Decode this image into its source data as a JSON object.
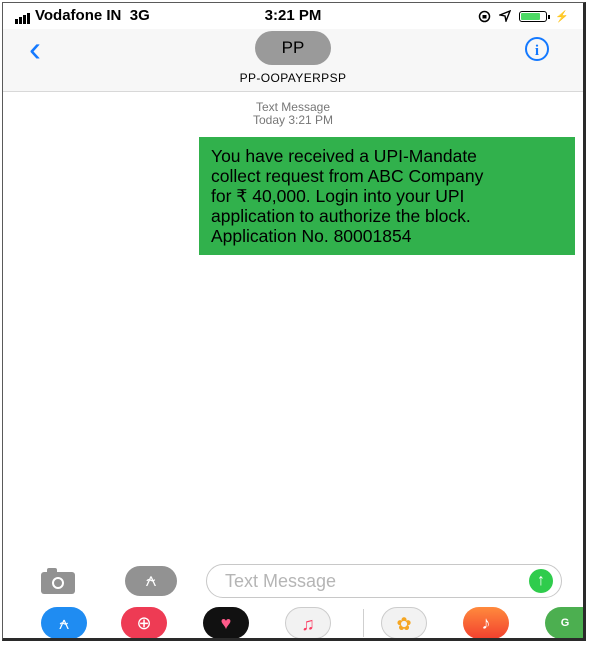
{
  "status_bar": {
    "carrier": "Vodafone IN",
    "network": "3G",
    "time": "3:21 PM",
    "battery_level": 0.8,
    "icons": [
      "signal-bars-icon",
      "lock-rotation-icon",
      "location-arrow-icon",
      "battery-icon",
      "charging-bolt-icon"
    ]
  },
  "header": {
    "back_icon": "chevron-left-icon",
    "avatar_initials": "PP",
    "contact_name": "PP-OOPAYERPSP",
    "info_icon": "info-icon"
  },
  "conversation": {
    "meta_label": "Text Message",
    "meta_timestamp": "Today 3:21 PM",
    "message": {
      "lines": [
        "You have received a UPI-Mandate",
        "collect request from ABC Company",
        "for ₹ 40,000. Login into your UPI",
        "application to authorize the block.",
        "Application No. 80001854"
      ],
      "bubble_color": "#31b14c"
    }
  },
  "composer": {
    "camera_icon": "camera-icon",
    "apps_icon": "app-store-icon",
    "placeholder": "Text Message",
    "send_icon": "arrow-up-icon"
  },
  "app_drawer": {
    "apps": [
      "app-store-icon",
      "search-images-icon",
      "digital-touch-icon",
      "music-icon",
      "photos-icon",
      "garageband-icon",
      "maps-icon"
    ]
  },
  "colors": {
    "accent": "#1479ff",
    "send": "#2fcc4c",
    "avatar": "#9a9a9a"
  }
}
